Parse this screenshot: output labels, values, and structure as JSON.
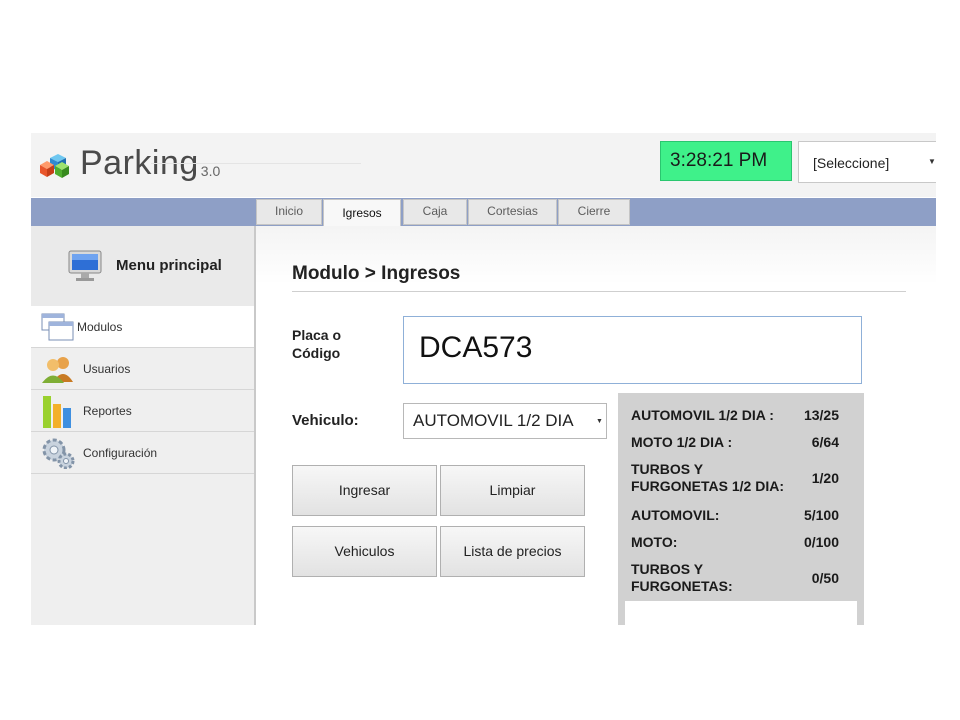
{
  "app": {
    "name": "Parking",
    "version": "3.0"
  },
  "header": {
    "clock": "3:28:21 PM",
    "select_value": "[Seleccione]"
  },
  "tabs": [
    {
      "label": "Inicio",
      "active": false
    },
    {
      "label": "Igresos",
      "active": true
    },
    {
      "label": "Caja",
      "active": false
    },
    {
      "label": "Cortesias",
      "active": false
    },
    {
      "label": "Cierre",
      "active": false
    }
  ],
  "sidebar": {
    "title": "Menu principal",
    "items": [
      {
        "label": "Modulos",
        "icon": "windows-icon",
        "active": true
      },
      {
        "label": "Usuarios",
        "icon": "users-icon",
        "active": false
      },
      {
        "label": "Reportes",
        "icon": "bar-chart-icon",
        "active": false
      },
      {
        "label": "Configuración",
        "icon": "gears-icon",
        "active": false
      }
    ]
  },
  "main": {
    "title": "Modulo > Ingresos",
    "placa_label_1": "Placa o",
    "placa_label_2": "Código",
    "placa_value": "DCA573",
    "vehiculo_label": "Vehiculo:",
    "vehiculo_value": "AUTOMOVIL 1/2 DIA",
    "buttons": {
      "ingresar": "Ingresar",
      "limpiar": "Limpiar",
      "vehiculos": "Vehiculos",
      "lista": "Lista de precios"
    }
  },
  "capacity": [
    {
      "label": "AUTOMOVIL 1/2 DIA :",
      "value": "13/25"
    },
    {
      "label": "MOTO 1/2 DIA :",
      "value": "6/64"
    },
    {
      "label_1": "TURBOS Y",
      "label_2": "FURGONETAS 1/2 DIA:",
      "value": "1/20"
    },
    {
      "label": "AUTOMOVIL:",
      "value": "5/100"
    },
    {
      "label": "MOTO:",
      "value": "0/100"
    },
    {
      "label_1": "TURBOS Y",
      "label_2": "FURGONETAS:",
      "value": "0/50"
    }
  ],
  "colors": {
    "clock_bg": "#3ff18a",
    "tabbar_bg": "#8e9fc6",
    "capacity_bg": "#d1d1d1"
  }
}
